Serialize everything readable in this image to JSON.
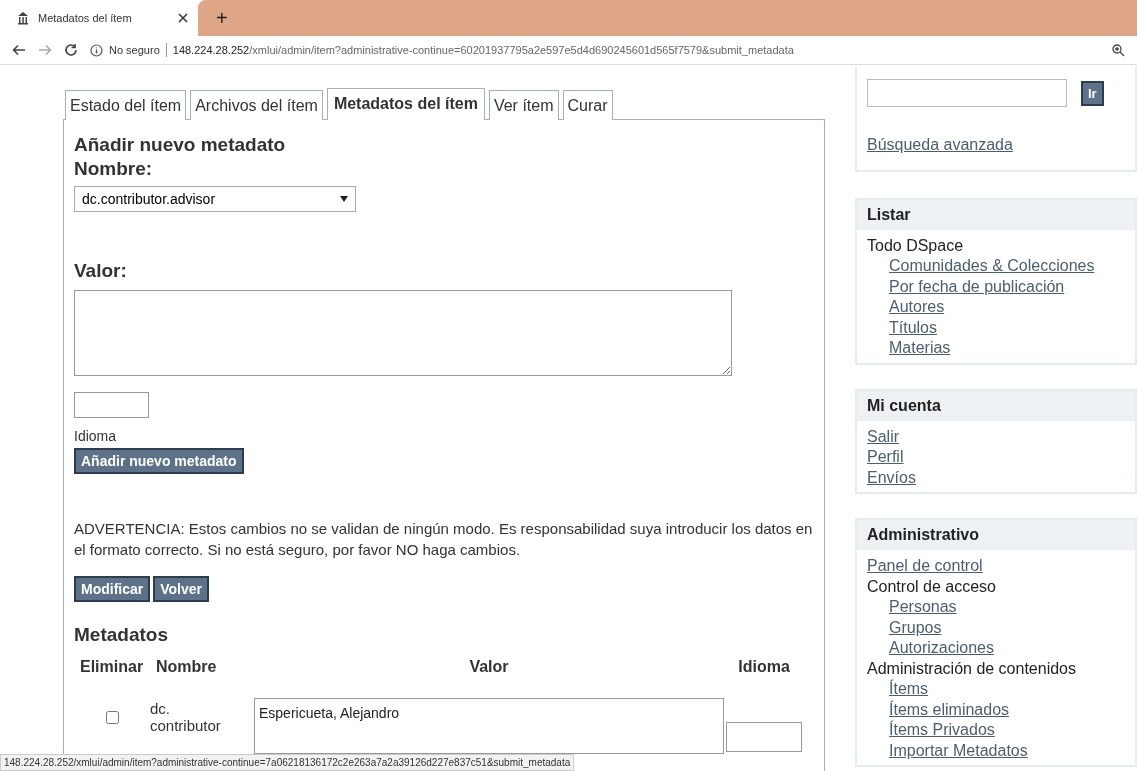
{
  "browser": {
    "tab_title": "Metadatos del ítem",
    "new_tab": "+",
    "security": "No seguro",
    "url_host": "148.224.28.252",
    "url_path": "/xmlui/admin/item?administrative-continue=60201937795a2e597e5d4d690245601d565f7579&submit_metadata"
  },
  "tabs": [
    {
      "label": "Estado del ítem",
      "selected": false
    },
    {
      "label": "Archivos del ítem",
      "selected": false
    },
    {
      "label": "Metadatos del ítem",
      "selected": true
    },
    {
      "label": "Ver ítem",
      "selected": false
    },
    {
      "label": "Curar",
      "selected": false
    }
  ],
  "form": {
    "heading": "Añadir nuevo metadato",
    "name_label": "Nombre:",
    "name_value": "dc.contributor.advisor",
    "value_label": "Valor:",
    "language_label": "Idioma",
    "add_button": "Añadir nuevo metadato",
    "warning": "ADVERTENCIA: Estos cambios no se validan de ningún modo. Es responsabilidad suya introducir los datos en el formato correcto. Si no está seguro, por favor NO haga cambios.",
    "buttons": [
      "Modificar",
      "Volver"
    ]
  },
  "metadata": {
    "heading": "Metadatos",
    "columns": [
      "Eliminar",
      "Nombre",
      "Valor",
      "Idioma"
    ],
    "rows": [
      {
        "name": "dc. contributor",
        "value": "Espericueta, Alejandro",
        "checked": false
      }
    ]
  },
  "sidebar": {
    "search_button": "Ir",
    "advanced_search": "Búsqueda avanzada",
    "sections": [
      {
        "title": "Listar",
        "items": [
          {
            "label": "Todo DSpace",
            "kind": "text",
            "children": [
              {
                "label": "Comunidades & Colecciones",
                "kind": "link"
              },
              {
                "label": "Por fecha de publicación",
                "kind": "link"
              },
              {
                "label": "Autores",
                "kind": "link"
              },
              {
                "label": "Títulos",
                "kind": "link"
              },
              {
                "label": "Materias",
                "kind": "link"
              }
            ]
          }
        ]
      },
      {
        "title": "Mi cuenta",
        "items": [
          {
            "label": "Salir",
            "kind": "link"
          },
          {
            "label": "Perfil",
            "kind": "link"
          },
          {
            "label": "Envíos",
            "kind": "link"
          }
        ]
      },
      {
        "title": "Administrativo",
        "items": [
          {
            "label": "Panel de control",
            "kind": "link"
          },
          {
            "label": "Control de acceso",
            "kind": "text",
            "children": [
              {
                "label": "Personas",
                "kind": "link"
              },
              {
                "label": "Grupos",
                "kind": "link"
              },
              {
                "label": "Autorizaciones",
                "kind": "link"
              }
            ]
          },
          {
            "label": "Administración de contenidos",
            "kind": "text",
            "children": [
              {
                "label": "Ítems",
                "kind": "link"
              },
              {
                "label": "Ítems eliminados",
                "kind": "link"
              },
              {
                "label": "Ítems Privados",
                "kind": "link"
              },
              {
                "label": "Importar Metadatos",
                "kind": "link"
              }
            ]
          }
        ]
      }
    ]
  },
  "status_url": "148.224.28.252/xmlui/admin/item?administrative-continue=7a06218136172c2e263a7a2a39126d227e837c51&submit_metadata"
}
